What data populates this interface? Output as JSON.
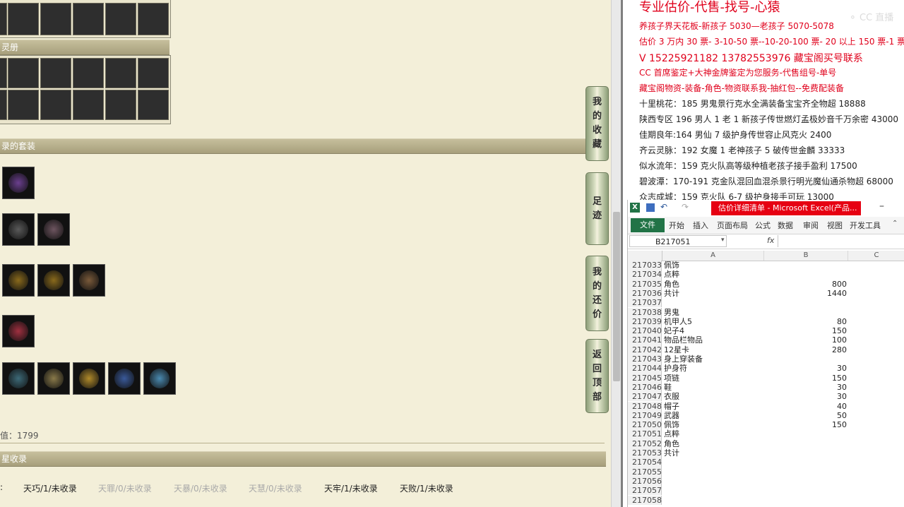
{
  "game": {
    "section_album": "灵册",
    "section_suits": "录的套装",
    "score_text": "值：1799",
    "section_collect": "星收录",
    "collect_prefix": ":",
    "collect_items": [
      {
        "label": "天巧/1/未收录",
        "dim": false
      },
      {
        "label": "天罪/0/未收录",
        "dim": true
      },
      {
        "label": "天暴/0/未收录",
        "dim": true
      },
      {
        "label": "天慧/0/未收录",
        "dim": true
      },
      {
        "label": "天牢/1/未收录",
        "dim": false
      },
      {
        "label": "天败/1/未收录",
        "dim": false
      }
    ],
    "side_buttons": [
      {
        "chars": [
          "我",
          "的",
          "收",
          "藏"
        ]
      },
      {
        "chars": [
          "足",
          "迹"
        ]
      },
      {
        "chars": [
          "我",
          "的",
          "还",
          "价"
        ]
      },
      {
        "chars": [
          "返",
          "回",
          "顶",
          "部"
        ]
      }
    ]
  },
  "doc": {
    "lines": [
      {
        "text": "专业估价-代售-找号-心猿",
        "cls": "red"
      },
      {
        "text": "养孩子界天花板-新孩子 5030—老孩子 5070-5078",
        "cls": "red"
      },
      {
        "text": "估价 3 万内 30 票- 3-10-50 票--10-20-100 票- 20 以上 150 票-1 票 1 元",
        "cls": "red"
      },
      {
        "text": "V 15225921182    13782553976    藏宝阁买号联系",
        "cls": "red"
      },
      {
        "text": "CC 首席鉴定+大神金牌鉴定为您服务-代售组号-单号",
        "cls": "red"
      },
      {
        "text": "藏宝阁物资-装备-角色-物资联系我-抽红包--免费配装备",
        "cls": "red"
      },
      {
        "text": "十里桃花：185 男鬼景行克水全满装备宝宝齐全物超 18888",
        "cls": ""
      },
      {
        "text": "陕西专区 196 男人 1 老 1 新孩子传世燃灯孟极妙音千万余密 43000",
        "cls": ""
      },
      {
        "text": "佳期良年:164 男仙 7 级护身传世容止风克火 2400",
        "cls": ""
      },
      {
        "text": "齐云灵脉：192 女魔 1 老神孩子 5 破传世金麟 33333",
        "cls": ""
      },
      {
        "text": "似水流年：159 克火队高等级种植老孩子接手盈利 17500",
        "cls": ""
      },
      {
        "text": "碧波潭：170-191 克金队混回血混杀景行明光魔仙通杀物超 68000",
        "cls": ""
      },
      {
        "text": "众志成城：159 克火队 6-7 级护身接手可玩 13000",
        "cls": ""
      }
    ]
  },
  "excel": {
    "title": "估价详细清单 - Microsoft Excel(产品...",
    "file_tab": "文件",
    "tabs": [
      "开始",
      "插入",
      "页面布局",
      "公式",
      "数据",
      "审阅",
      "视图",
      "开发工具"
    ],
    "name_box": "B217051",
    "fx": "fx",
    "columns": [
      "A",
      "B",
      "C"
    ],
    "rows": [
      {
        "n": "217033",
        "a": "佩饰",
        "b": ""
      },
      {
        "n": "217034",
        "a": "点粹",
        "b": ""
      },
      {
        "n": "217035",
        "a": "角色",
        "b": "800"
      },
      {
        "n": "217036",
        "a": "共计",
        "b": "1440"
      },
      {
        "n": "217037",
        "a": "",
        "b": ""
      },
      {
        "n": "217038",
        "a": "男鬼",
        "b": ""
      },
      {
        "n": "217039",
        "a": "机甲人5",
        "b": "80"
      },
      {
        "n": "217040",
        "a": "妃子4",
        "b": "150"
      },
      {
        "n": "217041",
        "a": "物品栏物品",
        "b": "100"
      },
      {
        "n": "217042",
        "a": "12星卡",
        "b": "280"
      },
      {
        "n": "217043",
        "a": "身上穿装备",
        "b": ""
      },
      {
        "n": "217044",
        "a": "护身符",
        "b": "30"
      },
      {
        "n": "217045",
        "a": "项链",
        "b": "150"
      },
      {
        "n": "217046",
        "a": "鞋",
        "b": "30"
      },
      {
        "n": "217047",
        "a": "衣服",
        "b": "30"
      },
      {
        "n": "217048",
        "a": "帽子",
        "b": "40"
      },
      {
        "n": "217049",
        "a": "武器",
        "b": "50"
      },
      {
        "n": "217050",
        "a": "佩饰",
        "b": "150"
      },
      {
        "n": "217051",
        "a": "点粹",
        "b": ""
      },
      {
        "n": "217052",
        "a": "角色",
        "b": ""
      },
      {
        "n": "217053",
        "a": "共计",
        "b": ""
      },
      {
        "n": "217054",
        "a": "",
        "b": ""
      },
      {
        "n": "217055",
        "a": "",
        "b": ""
      },
      {
        "n": "217056",
        "a": "",
        "b": ""
      },
      {
        "n": "217057",
        "a": "",
        "b": ""
      },
      {
        "n": "217058",
        "a": "",
        "b": ""
      }
    ]
  },
  "colors": {
    "red": "#e0001b",
    "excel_green": "#217346",
    "bar": "#a79f7c"
  }
}
